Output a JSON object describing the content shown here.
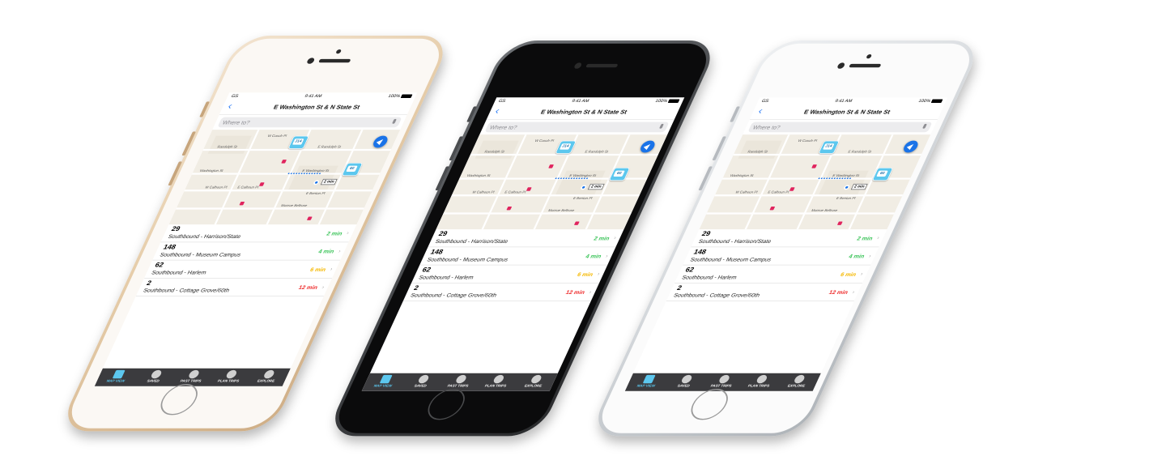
{
  "status": {
    "carrier": "GS",
    "time": "9:41 AM",
    "battery": "100%"
  },
  "nav": {
    "back_glyph": "‹",
    "title": "E Washington St & N State St"
  },
  "search": {
    "placeholder": "Where to?"
  },
  "map": {
    "streets": {
      "w_couch": "W Couch Pl",
      "randolph_w": "Randolph St",
      "randolph_e": "E Randolph St",
      "washington_w": "Washington St",
      "washington_e": "E Washington St",
      "calhoun_w": "W Calhoun Pl",
      "calhoun_e": "E Calhoun Pl",
      "madison": "Monroe Bellrose",
      "benton": "E Benton Pl"
    },
    "bus_badges": [
      "J14",
      "60"
    ],
    "walk_label": "2 min",
    "locate_icon": "location-arrow-icon"
  },
  "arrivals": [
    {
      "route": "29",
      "dest": "Southbound - Harrison/State",
      "eta": "2 min",
      "color": "#3cc45a"
    },
    {
      "route": "148",
      "dest": "Southbound - Museum Campus",
      "eta": "4 min",
      "color": "#3cc45a"
    },
    {
      "route": "62",
      "dest": "Southbound - Harlem",
      "eta": "6 min",
      "color": "#f5b800"
    },
    {
      "route": "2",
      "dest": "Southbound - Cottage Grove/60th",
      "eta": "12 min",
      "color": "#ee2b2b"
    }
  ],
  "tabs": [
    {
      "label": "MAP VIEW",
      "icon": "map-icon"
    },
    {
      "label": "SAVED",
      "icon": "heart-icon"
    },
    {
      "label": "PAST TRIPS",
      "icon": "clock-icon"
    },
    {
      "label": "PLAN TRIPS",
      "icon": "calendar-icon"
    },
    {
      "label": "EXPLORE",
      "icon": "pin-icon"
    }
  ],
  "colors": {
    "accent": "#5cc7ee",
    "tabbar": "#3b3b3e",
    "back": "#2a7bf6"
  }
}
